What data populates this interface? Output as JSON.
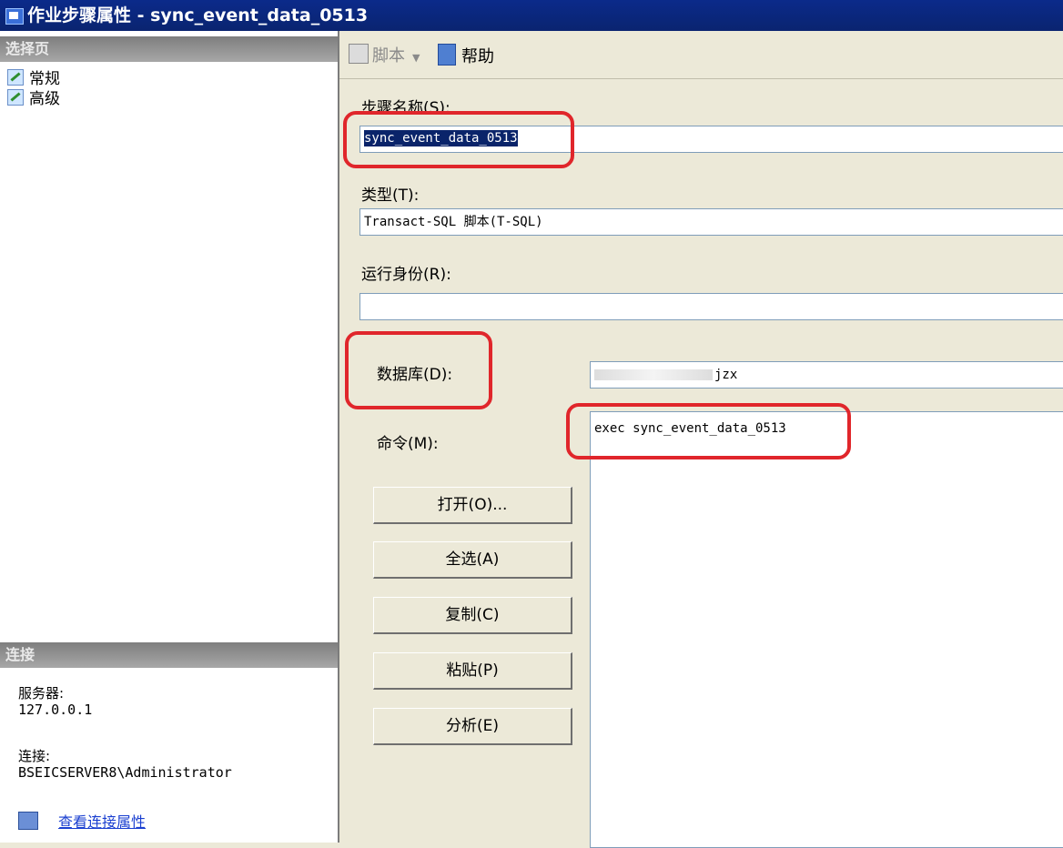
{
  "window": {
    "title": "作业步骤属性 - sync_event_data_0513"
  },
  "left_pane": {
    "pages_header": "选择页",
    "pages": [
      {
        "label": "常规"
      },
      {
        "label": "高级"
      }
    ],
    "connection_header": "连接",
    "server_label": "服务器:",
    "server_value": "127.0.0.1",
    "connection_label": "连接:",
    "connection_value": "BSEICSERVER8\\Administrator",
    "view_connection_link": "查看连接属性"
  },
  "toolbar": {
    "script_label": "脚本",
    "script_dropdown": "▼",
    "help_label": "帮助"
  },
  "form": {
    "step_name_label": "步骤名称(S):",
    "step_name_value": "sync_event_data_0513",
    "type_label": "类型(T):",
    "type_value": "Transact-SQL 脚本(T-SQL)",
    "run_as_label": "运行身份(R):",
    "run_as_value": "",
    "database_label": "数据库(D):",
    "database_value": "jzx",
    "command_label": "命令(M):",
    "command_value": "exec sync_event_data_0513"
  },
  "command_buttons": {
    "open": "打开(O)...",
    "select_all": "全选(A)",
    "copy": "复制(C)",
    "paste": "粘贴(P)",
    "parse": "分析(E)"
  },
  "colors": {
    "highlight_box": "#e0262b",
    "title_bar": "#0b2a8a",
    "selection": "#0a246a",
    "link": "#1a3fd0"
  }
}
